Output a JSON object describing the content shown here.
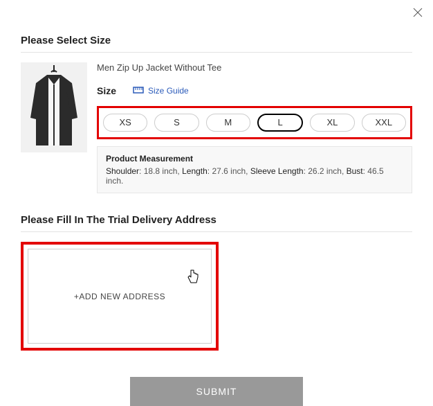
{
  "meta": {
    "domain": "Computer-Use"
  },
  "close_label": "×",
  "section1": {
    "title": "Please Select Size",
    "product_title": "Men Zip Up Jacket Without Tee",
    "size_label": "Size",
    "size_guide_label": "Size Guide",
    "sizes": [
      "XS",
      "S",
      "M",
      "L",
      "XL",
      "XXL"
    ],
    "selected_size_index": 3,
    "measurement": {
      "title": "Product Measurement",
      "items": [
        {
          "label": "Shoulder",
          "value": "18.8 inch"
        },
        {
          "label": "Length",
          "value": "27.6 inch"
        },
        {
          "label": "Sleeve Length",
          "value": "26.2 inch"
        },
        {
          "label": "Bust",
          "value": "46.5 inch."
        }
      ]
    }
  },
  "section2": {
    "title": "Please Fill In The Trial Delivery Address",
    "add_label": "+ADD NEW ADDRESS"
  },
  "submit_label": "SUBMIT"
}
